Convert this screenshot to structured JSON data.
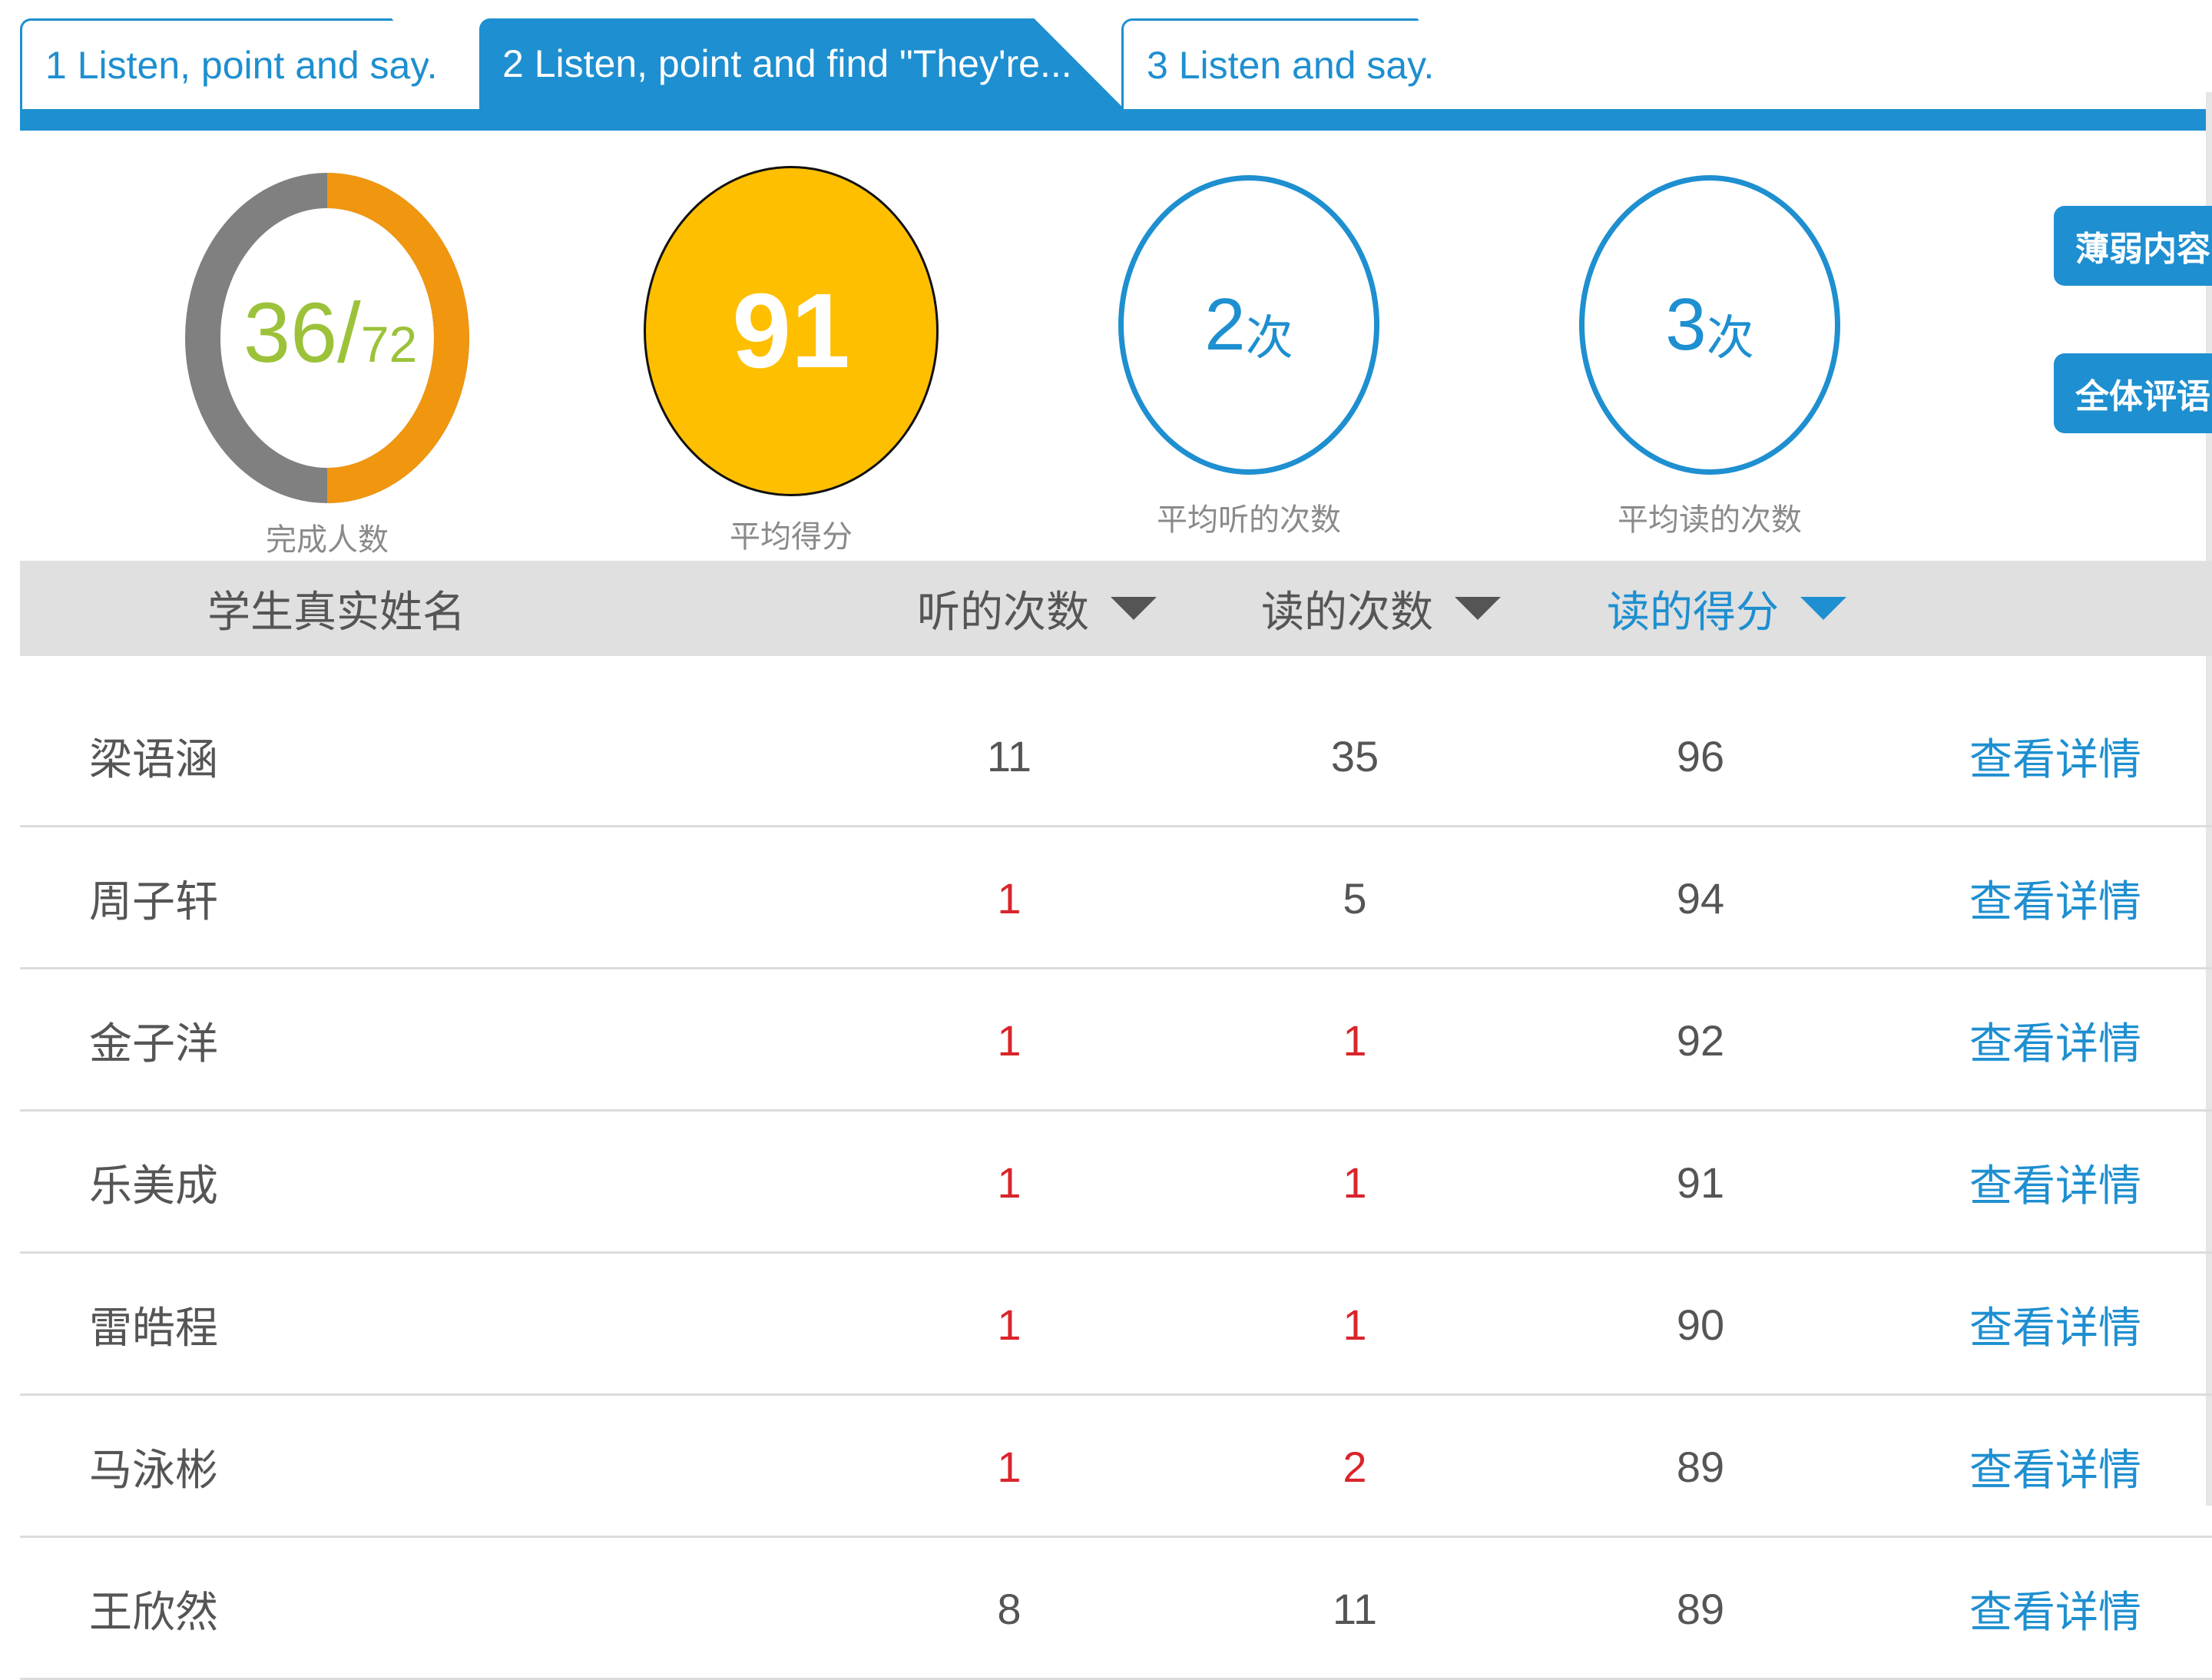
{
  "tabs": [
    {
      "label": "1 Listen, point and say.",
      "active": false
    },
    {
      "label": "2 Listen, point and find \"They're...",
      "active": true
    },
    {
      "label": "3 Listen and say.",
      "active": false
    }
  ],
  "stats": {
    "completion": {
      "done": "36/",
      "total": "72",
      "label": "完成人数",
      "done_fraction": 0.5
    },
    "average_score": {
      "value": "91",
      "label": "平均得分"
    },
    "avg_listen": {
      "value": "2",
      "unit": "次",
      "label": "平均听的次数"
    },
    "avg_read": {
      "value": "3",
      "unit": "次",
      "label": "平均读的次数"
    }
  },
  "side_buttons": {
    "weak": "薄弱内容",
    "comment": "全体评语"
  },
  "table": {
    "headers": {
      "name": "学生真实姓名",
      "listen": "听的次数",
      "read": "读的次数",
      "score": "读的得分"
    },
    "rows": [
      {
        "name": "梁语涵",
        "listen": "11",
        "read": "35",
        "score": "96",
        "action": "查看详情",
        "listen_red": false,
        "read_red": false
      },
      {
        "name": "周子轩",
        "listen": "1",
        "read": "5",
        "score": "94",
        "action": "查看详情",
        "listen_red": true,
        "read_red": false
      },
      {
        "name": "金子洋",
        "listen": "1",
        "read": "1",
        "score": "92",
        "action": "查看详情",
        "listen_red": true,
        "read_red": true
      },
      {
        "name": "乐美成",
        "listen": "1",
        "read": "1",
        "score": "91",
        "action": "查看详情",
        "listen_red": true,
        "read_red": true
      },
      {
        "name": "雷皓程",
        "listen": "1",
        "read": "1",
        "score": "90",
        "action": "查看详情",
        "listen_red": true,
        "read_red": true
      },
      {
        "name": "马泳彬",
        "listen": "1",
        "read": "2",
        "score": "89",
        "action": "查看详情",
        "listen_red": true,
        "read_red": true
      },
      {
        "name": "王欣然",
        "listen": "8",
        "read": "11",
        "score": "89",
        "action": "查看详情",
        "listen_red": false,
        "read_red": false
      }
    ]
  },
  "colors": {
    "accent": "#1e8fd0",
    "score_circle": "#fdbf00",
    "ring_done": "#f0960f",
    "ring_remaining": "#808080",
    "ring_text": "#9cc23a",
    "low_count": "#d9252b"
  }
}
